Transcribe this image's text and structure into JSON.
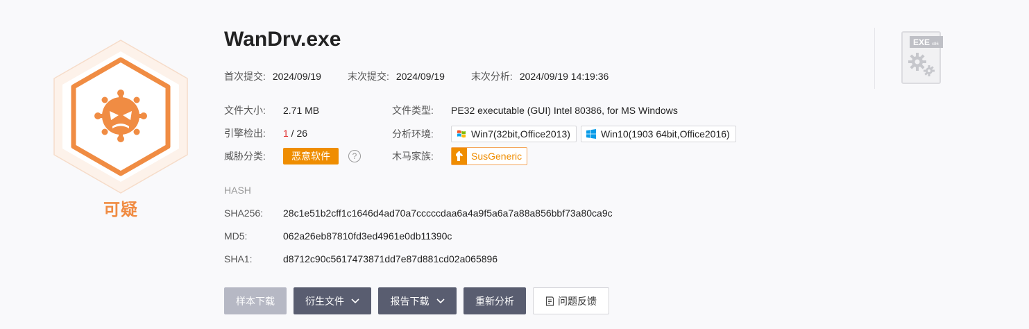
{
  "file": {
    "name": "WanDrv.exe",
    "verdict": "可疑",
    "first_submit_label": "首次提交:",
    "first_submit": "2024/09/19",
    "last_submit_label": "末次提交:",
    "last_submit": "2024/09/19",
    "last_analysis_label": "末次分析:",
    "last_analysis": "2024/09/19 14:19:36"
  },
  "info": {
    "size_label": "文件大小:",
    "size": "2.71 MB",
    "engines_label": "引擎检出:",
    "engines_detected": "1",
    "engines_sep": " / ",
    "engines_total": "26",
    "threat_label": "威胁分类:",
    "threat": "恶意软件",
    "help_icon": "?",
    "type_label": "文件类型:",
    "type": "PE32 executable (GUI) Intel 80386, for MS Windows",
    "env_label": "分析环境:",
    "envs": [
      "Win7(32bit,Office2013)",
      "Win10(1903 64bit,Office2016)"
    ],
    "family_label": "木马家族:",
    "family": "SusGeneric"
  },
  "hash": {
    "heading": "HASH",
    "sha256_label": "SHA256:",
    "sha256": "28c1e51b2cff1c1646d4ad70a7cccccdaa6a4a9f5a6a7a88a856bbf73a80ca9c",
    "md5_label": "MD5:",
    "md5": "062a26eb87810fd3ed4961e0db11390c",
    "sha1_label": "SHA1:",
    "sha1": "d8712c90c5617473871dd7e87d881cd02a065896"
  },
  "actions": {
    "download_sample": "样本下载",
    "derived_files": "衍生文件",
    "report_download": "报告下载",
    "reanalyze": "重新分析",
    "feedback": "问题反馈"
  },
  "filetype_badge": {
    "text": "EXE",
    "arch": "x86"
  },
  "colors": {
    "accent": "#f08c43",
    "malware": "#ef8d00",
    "button_dark": "#595d70",
    "button_disabled": "#b6b8c4"
  }
}
